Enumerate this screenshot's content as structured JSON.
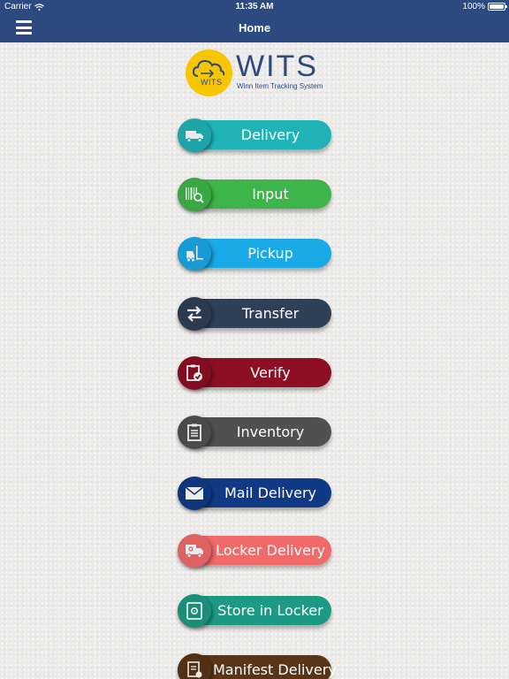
{
  "status_bar": {
    "carrier": "Carrier",
    "time": "11:35 AM",
    "battery": "100%"
  },
  "nav": {
    "title": "Home"
  },
  "logo": {
    "badge_text": "WITS",
    "wordmark": "WITS",
    "subtitle": "Winn Item Tracking System"
  },
  "menu": {
    "items": [
      {
        "label": "Delivery",
        "icon": "truck-icon",
        "color": "#1fb3b8"
      },
      {
        "label": "Input",
        "icon": "barcode-search-icon",
        "color": "#3db54a"
      },
      {
        "label": "Pickup",
        "icon": "forklift-icon",
        "color": "#19a9e6"
      },
      {
        "label": "Transfer",
        "icon": "transfer-arrows-icon",
        "color": "#2f3f55"
      },
      {
        "label": "Verify",
        "icon": "clipboard-check-icon",
        "color": "#8e0e23"
      },
      {
        "label": "Inventory",
        "icon": "clipboard-list-icon",
        "color": "#505050"
      },
      {
        "label": "Mail Delivery",
        "icon": "envelope-icon",
        "color": "#113a86"
      },
      {
        "label": "Locker Delivery",
        "icon": "locker-truck-icon",
        "color": "#f16a6a"
      },
      {
        "label": "Store in Locker",
        "icon": "safe-icon",
        "color": "#1d9a86"
      },
      {
        "label": "Manifest Delivery",
        "icon": "manifest-icon",
        "color": "#5a3416"
      }
    ]
  }
}
